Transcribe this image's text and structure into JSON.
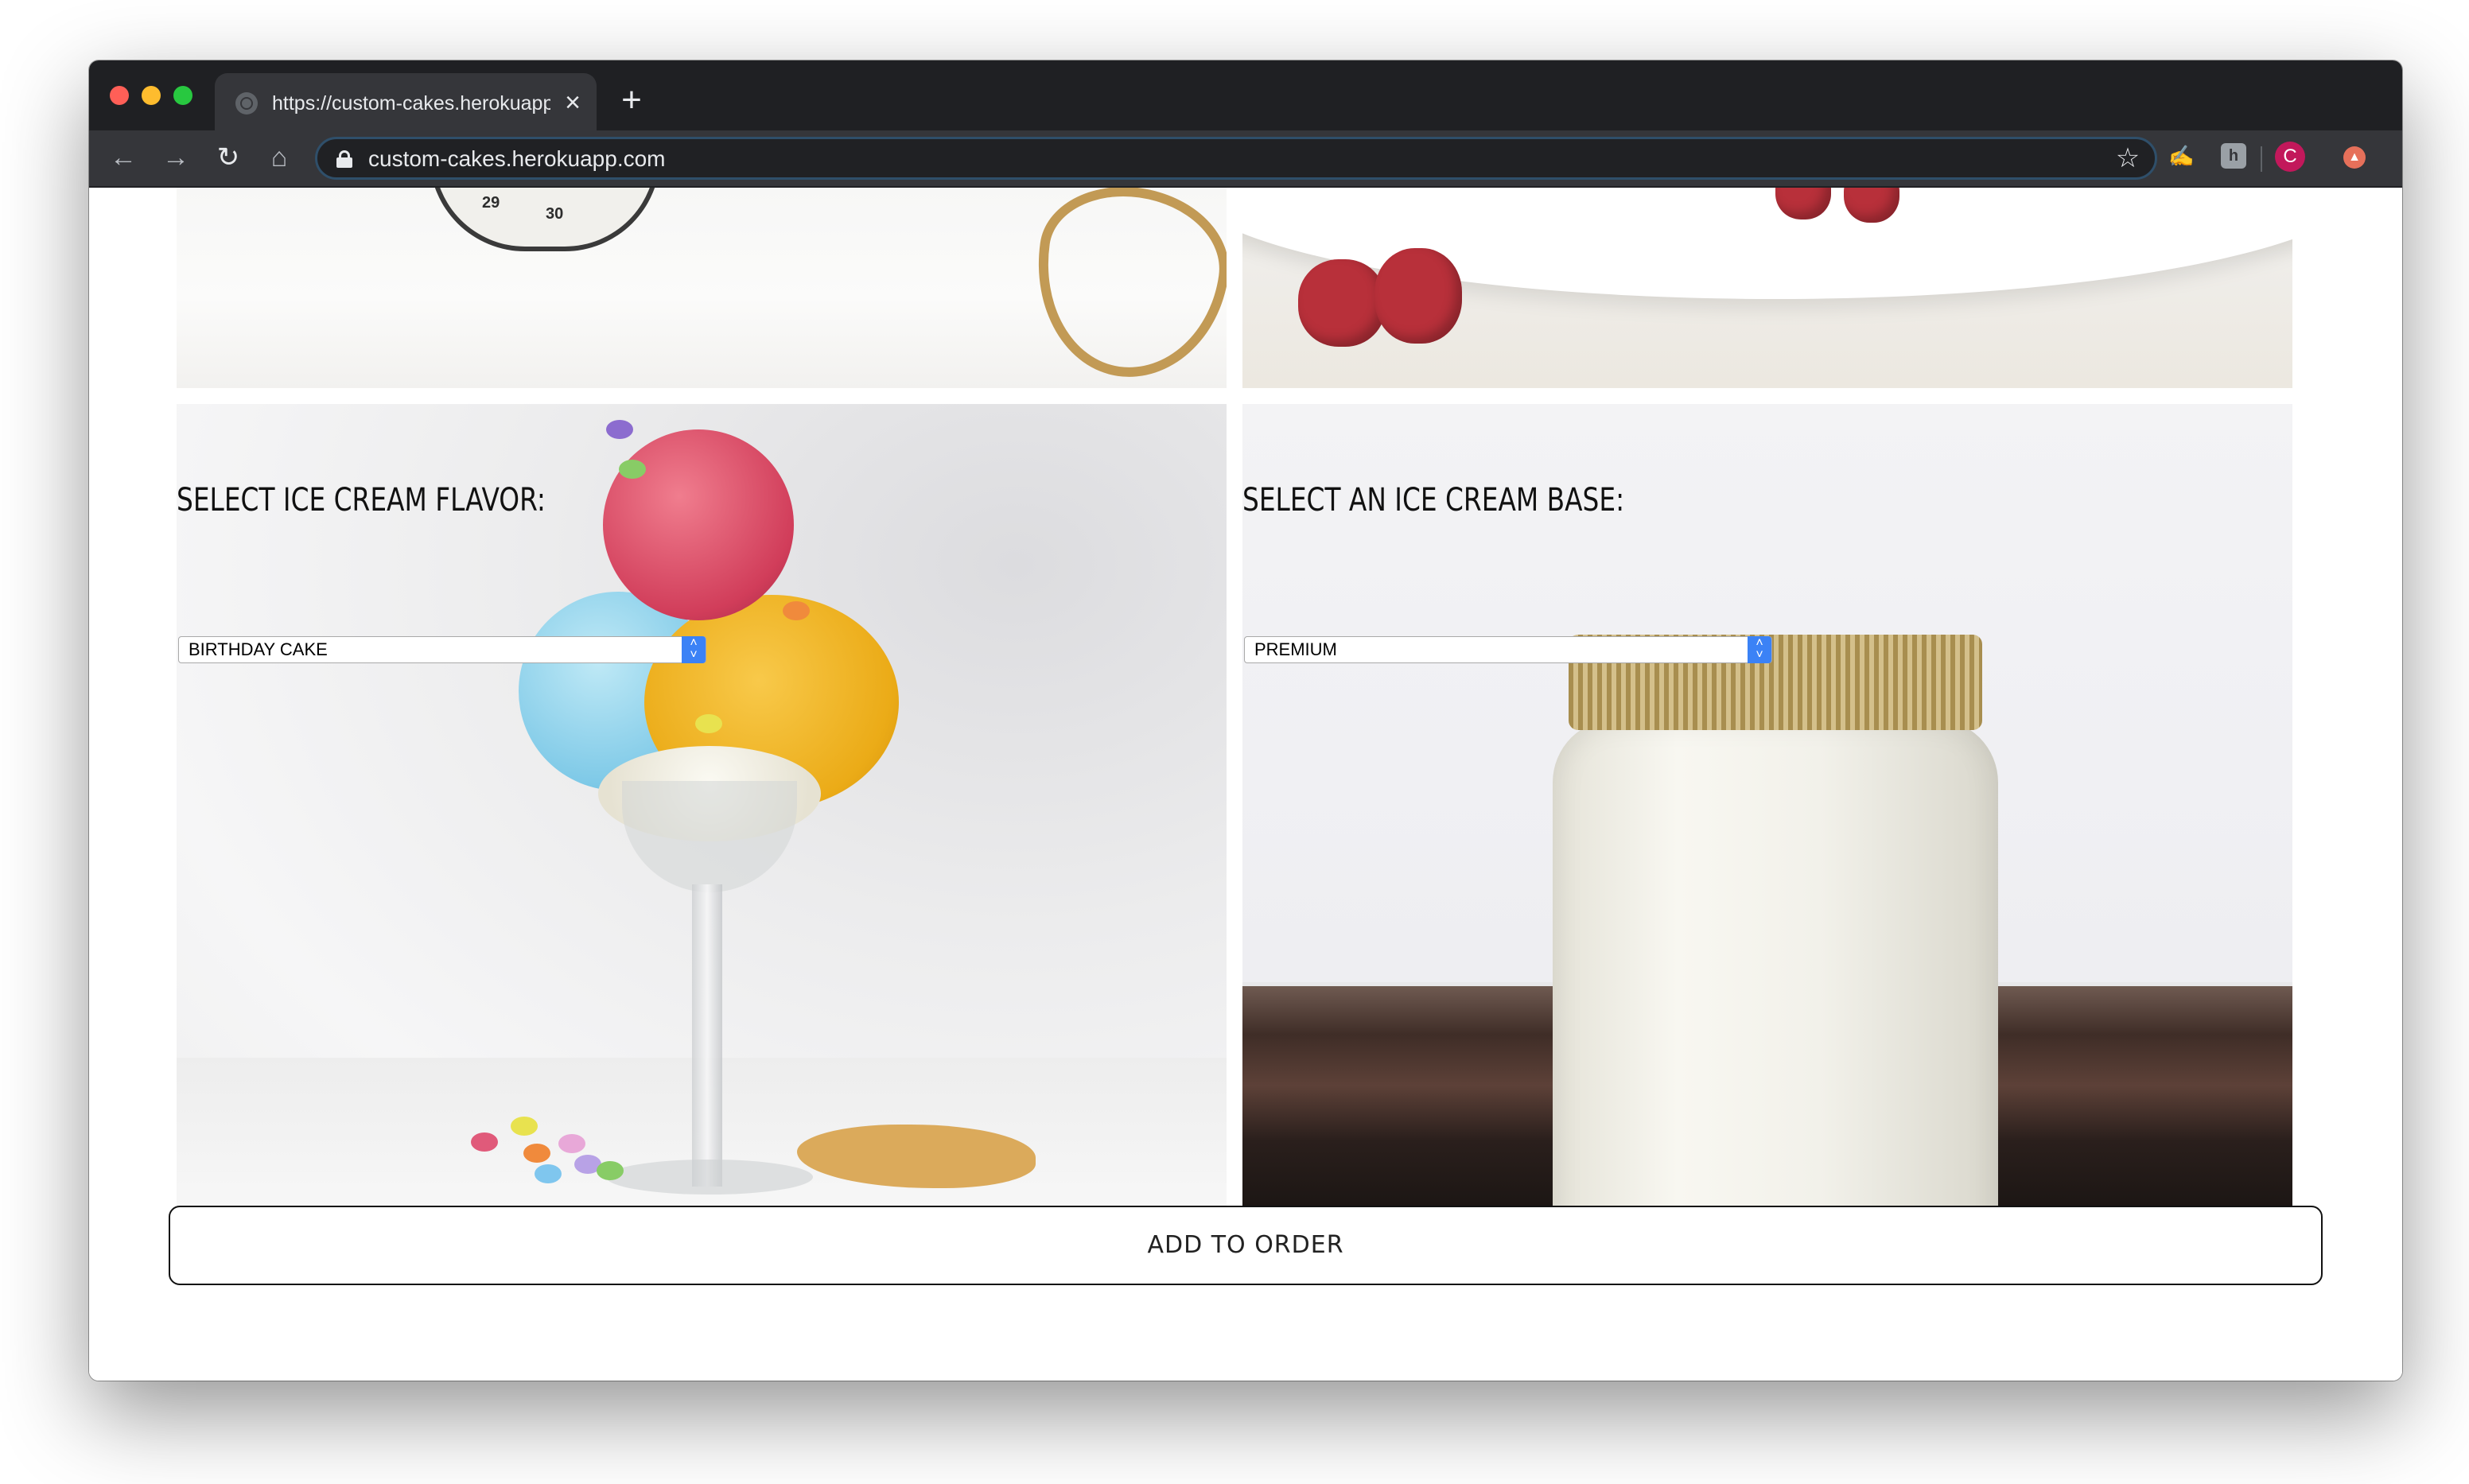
{
  "browser": {
    "tab": {
      "title": "https://custom-cakes.herokuapp.com"
    },
    "address_bar": {
      "url": "custom-cakes.herokuapp.com"
    },
    "profile": {
      "initial": "C",
      "color": "#c2185b"
    },
    "extensions": {
      "middle_badge": "h"
    }
  },
  "page": {
    "flavor_section": {
      "title": "SELECT ICE CREAM FLAVOR:",
      "selected": "BIRTHDAY CAKE"
    },
    "base_section": {
      "title": "SELECT AN ICE CREAM BASE:",
      "selected": "PREMIUM"
    },
    "add_to_order": {
      "label": "ADD TO ORDER"
    },
    "top_left_image": {
      "tape_numbers": [
        "29",
        "30"
      ]
    },
    "accent_color": "#3b82f6"
  }
}
